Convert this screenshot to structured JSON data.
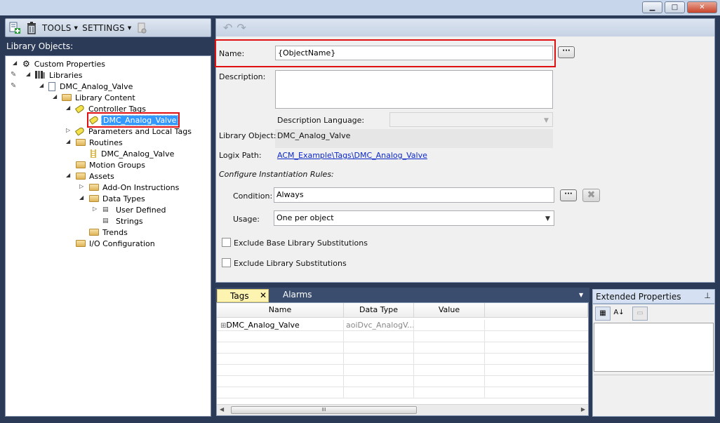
{
  "window": {
    "minimize_glyph": "▁",
    "maximize_glyph": "□",
    "close_glyph": "✕"
  },
  "toolbar": {
    "tools_label": "TOOLS",
    "settings_label": "SETTINGS"
  },
  "library": {
    "header": "Library Objects:",
    "tree": {
      "custom_properties": "Custom Properties",
      "libraries": "Libraries",
      "object": "DMC_Analog_Valve",
      "library_content": "Library Content",
      "controller_tags": "Controller Tags",
      "controller_tag_item": "DMC_Analog_Valve",
      "parameters": "Parameters and Local Tags",
      "routines": "Routines",
      "routine_item": "DMC_Analog_Valve",
      "motion_groups": "Motion Groups",
      "assets": "Assets",
      "addon_instructions": "Add-On Instructions",
      "data_types": "Data Types",
      "user_defined": "User Defined",
      "strings": "Strings",
      "trends": "Trends",
      "io_configuration": "I/O Configuration"
    }
  },
  "properties": {
    "name_label": "Name:",
    "name_value": "{ObjectName}",
    "ellipsis": "···",
    "description_label": "Description:",
    "description_value": "",
    "description_language_label": "Description Language:",
    "description_language_value": "",
    "library_object_label": "Library Object:",
    "library_object_value": "DMC_Analog_Valve",
    "logix_path_label": "Logix Path:",
    "logix_path_value": "ACM_Example\\Tags\\DMC_Analog_Valve",
    "instantiation_rules_label": "Configure Instantiation Rules:",
    "condition_label": "Condition:",
    "condition_value": "Always",
    "usage_label": "Usage:",
    "usage_value": "One per object",
    "exclude_base_label": "Exclude Base Library Substitutions",
    "exclude_library_label": "Exclude Library Substitutions",
    "exclude_base_checked": false,
    "exclude_library_checked": false
  },
  "tags_panel": {
    "tabs": [
      "Tags",
      "Alarms"
    ],
    "tab_close": "✕",
    "columns": [
      "Name",
      "Data Type",
      "Value"
    ],
    "rows": [
      {
        "expand": "⊞",
        "name": "DMC_Analog_Valve",
        "data_type": "aoiDvc_AnalogV...",
        "value": ""
      }
    ],
    "scroll_grip": "III"
  },
  "extended_properties": {
    "title": "Extended Properties",
    "pin_glyph": "📌"
  },
  "colors": {
    "background": "#2b3a57",
    "selection": "#3399ff",
    "highlight_box": "#e01010",
    "active_tab": "#fef4b1",
    "link": "#0a27c9"
  }
}
